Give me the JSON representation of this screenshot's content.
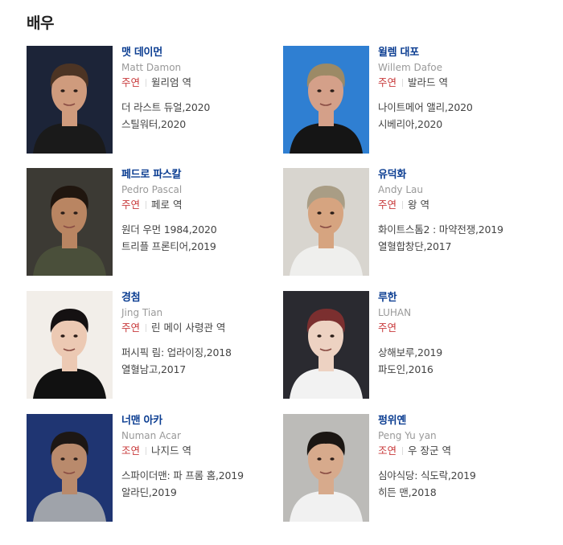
{
  "section_title": "배우",
  "actors": [
    {
      "name": "맷 데이먼",
      "eng": "Matt Damon",
      "role": "주연",
      "char": "윌리엄 역",
      "works": [
        "더 라스트 듀얼,2020",
        "스틸워터,2020"
      ],
      "palette": {
        "bg": "#1c2438",
        "skin": "#cf9b7d",
        "hair": "#4c3424",
        "shirt": "#1a1a1a"
      }
    },
    {
      "name": "윌렘 대포",
      "eng": "Willem Dafoe",
      "role": "주연",
      "char": "발라드 역",
      "works": [
        "나이트메어 앨리,2020",
        "시베리아,2020"
      ],
      "palette": {
        "bg": "#2f7fd2",
        "skin": "#d4a089",
        "hair": "#9c8a66",
        "shirt": "#151515"
      }
    },
    {
      "name": "페드로 파스칼",
      "eng": "Pedro Pascal",
      "role": "주연",
      "char": "페로 역",
      "works": [
        "원더 우먼 1984,2020",
        "트리플 프론티어,2019"
      ],
      "palette": {
        "bg": "#3c3a34",
        "skin": "#b98562",
        "hair": "#20160f",
        "shirt": "#4a4f3a"
      }
    },
    {
      "name": "유덕화",
      "eng": "Andy Lau",
      "role": "주연",
      "char": "왕 역",
      "works": [
        "화이트스톰2 : 마약전쟁,2019",
        "열혈합창단,2017"
      ],
      "palette": {
        "bg": "#d8d5cf",
        "skin": "#d6a480",
        "hair": "#a99d85",
        "shirt": "#efefed"
      }
    },
    {
      "name": "경첨",
      "eng": "Jing Tian",
      "role": "주연",
      "char": "린 메이 사령관 역",
      "works": [
        "퍼시픽 림: 업라이징,2018",
        "열혈남고,2017"
      ],
      "palette": {
        "bg": "#f2eee9",
        "skin": "#ecc9b3",
        "hair": "#151112",
        "shirt": "#111111"
      }
    },
    {
      "name": "루한",
      "eng": "LUHAN",
      "role": "주연",
      "char": "",
      "works": [
        "상해보루,2019",
        "파도인,2016"
      ],
      "palette": {
        "bg": "#2a2a30",
        "skin": "#edd2c2",
        "hair": "#7b2f2f",
        "shirt": "#f2f2f2"
      }
    },
    {
      "name": "너맨 아카",
      "eng": "Numan Acar",
      "role": "조연",
      "char": "나지드 역",
      "works": [
        "스파이더맨: 파 프롬 홈,2019",
        "알라딘,2019"
      ],
      "palette": {
        "bg": "#1f3572",
        "skin": "#b98a6c",
        "hair": "#1d1714",
        "shirt": "#9fa3aa"
      }
    },
    {
      "name": "펑위옌",
      "eng": "Peng Yu yan",
      "role": "조연",
      "char": "우 장군 역",
      "works": [
        "심야식당: 식도락,2019",
        "히든 맨,2018"
      ],
      "palette": {
        "bg": "#bcbbb8",
        "skin": "#d7aa8c",
        "hair": "#1b1613",
        "shirt": "#f1f1f1"
      }
    }
  ]
}
